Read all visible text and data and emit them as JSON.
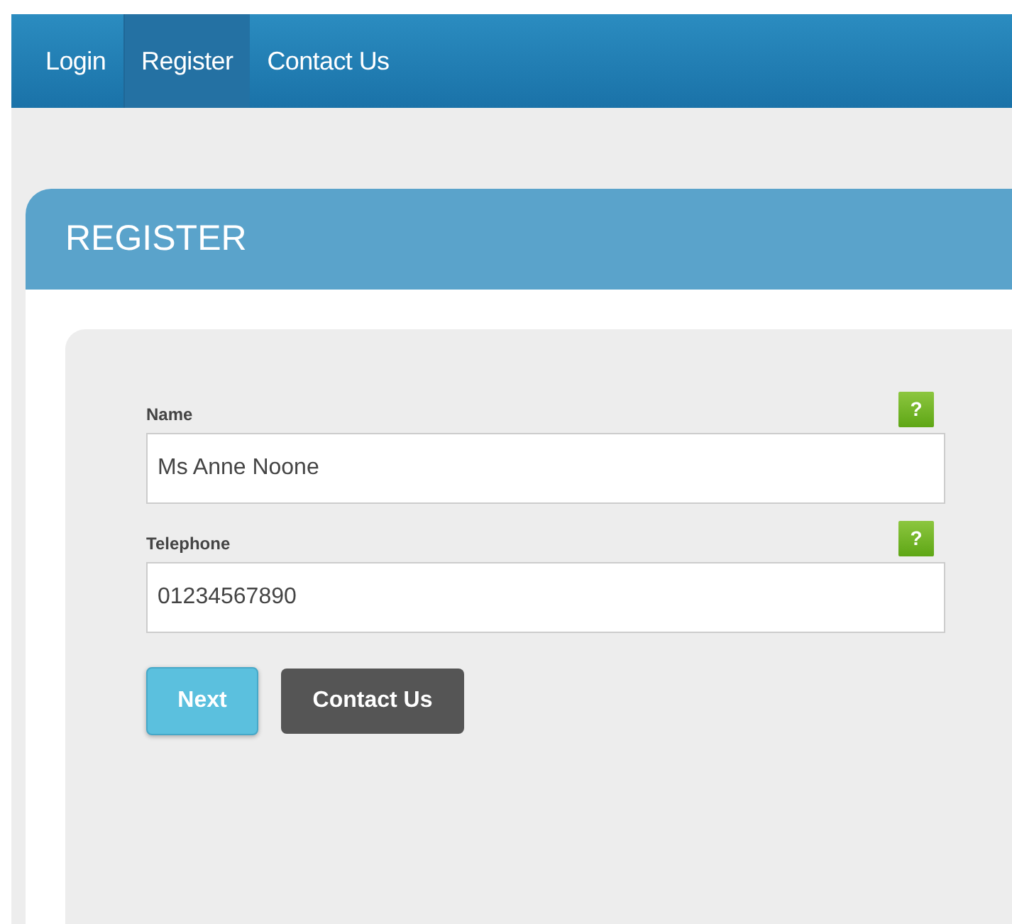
{
  "nav": [
    {
      "label": "Login",
      "selected": false
    },
    {
      "label": "Register",
      "selected": true
    },
    {
      "label": "Contact Us",
      "selected": false
    }
  ],
  "panel": {
    "title": "REGISTER"
  },
  "fields": [
    {
      "label": "Name",
      "value": "Ms Anne Noone",
      "help": "?"
    },
    {
      "label": "Telephone",
      "value": "01234567890",
      "help": "?"
    }
  ],
  "buttons": [
    {
      "label": "Next",
      "kind": "primary"
    },
    {
      "label": "Contact Us",
      "kind": "secondary"
    }
  ]
}
